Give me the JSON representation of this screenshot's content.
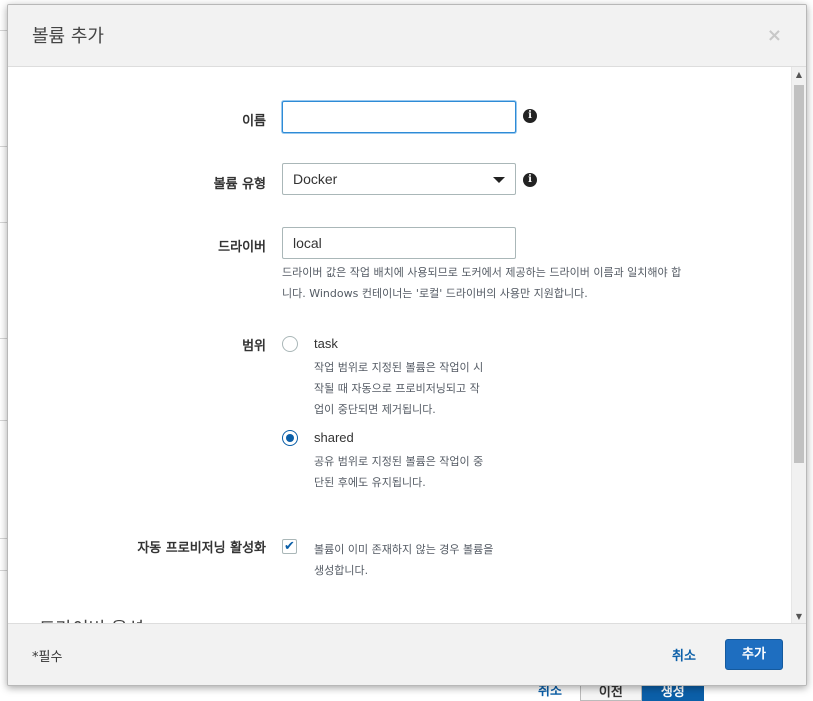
{
  "dialog": {
    "title": "볼륨 추가",
    "close_glyph": "×"
  },
  "form": {
    "name": {
      "label": "이름",
      "value": "",
      "placeholder": ""
    },
    "volume_type": {
      "label": "볼륨 유형",
      "selected": "Docker"
    },
    "driver": {
      "label": "드라이버",
      "value": "local",
      "help_line1": "드라이버 값은 작업 배치에 사용되므로 도커에서 제공하는 드라이버 이름과 일치해야 합",
      "help_line2": "니다. Windows 컨테이너는 '로컬' 드라이버의 사용만 지원합니다."
    },
    "scope": {
      "label": "범위",
      "options": [
        {
          "value": "task",
          "checked": false,
          "help": [
            "작업 범위로 지정된 볼륨은 작업이 시",
            "작될 때 자동으로 프로비저닝되고 작",
            "업이 중단되면 제거됩니다."
          ]
        },
        {
          "value": "shared",
          "checked": true,
          "help": [
            "공유 범위로 지정된 볼륨은 작업이 중",
            "단된 후에도 유지됩니다."
          ]
        }
      ]
    },
    "autoprovision": {
      "label": "자동 프로비저닝 활성화",
      "checked": true,
      "help": [
        "볼륨이 이미 존재하지 않는 경우 볼륨을",
        "생성합니다."
      ]
    },
    "driver_options_heading": "드라이버 옵션"
  },
  "footer": {
    "required_note": "*필수",
    "cancel_label": "취소",
    "add_label": "추가"
  },
  "background": {
    "footer_buttons": [
      "취소",
      "이전",
      "생성"
    ]
  },
  "colors": {
    "primary": "#1e6ec0",
    "link": "#0b5fa8",
    "focus": "#2e8bd6"
  }
}
